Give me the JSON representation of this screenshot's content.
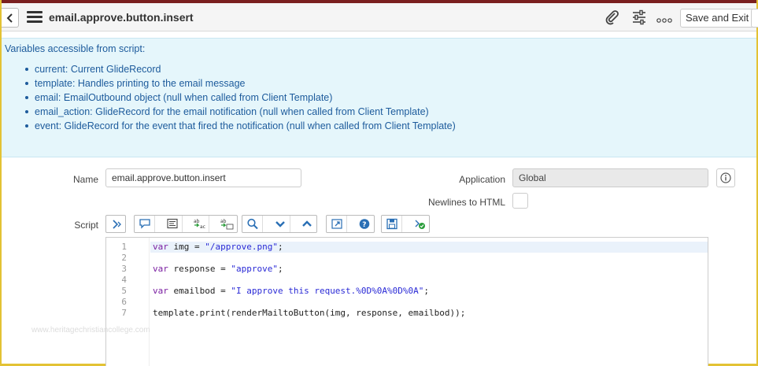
{
  "header": {
    "title": "email.approve.button.insert",
    "save_exit_label": "Save and Exit",
    "icons": [
      "back-chevron-icon",
      "hamburger-menu-icon",
      "paperclip-icon",
      "sliders-icon",
      "more-icon"
    ]
  },
  "info": {
    "title": "Variables accessible from script:",
    "items": [
      "current: Current GlideRecord",
      "template: Handles printing to the email message",
      "email: EmailOutbound object (null when called from Client Template)",
      "email_action: GlideRecord for the email notification (null when called from Client Template)",
      "event: GlideRecord for the event that fired the notification (null when called from Client Template)"
    ],
    "color": "#1d5b9c",
    "background": "#e5f6fb"
  },
  "form": {
    "name_label": "Name",
    "name_value": "email.approve.button.insert",
    "application_label": "Application",
    "application_value": "Global",
    "newlines_label": "Newlines to HTML",
    "script_label": "Script"
  },
  "editor": {
    "lines": [
      {
        "num": "1",
        "tokens": [
          {
            "t": "var",
            "c": "kw"
          },
          {
            "t": " img = ",
            "c": ""
          },
          {
            "t": "\"/approve.png\"",
            "c": "str"
          },
          {
            "t": ";",
            "c": ""
          }
        ]
      },
      {
        "num": "2",
        "tokens": []
      },
      {
        "num": "3",
        "tokens": [
          {
            "t": "var",
            "c": "kw"
          },
          {
            "t": " response = ",
            "c": ""
          },
          {
            "t": "\"approve\"",
            "c": "str"
          },
          {
            "t": ";",
            "c": ""
          }
        ]
      },
      {
        "num": "4",
        "tokens": []
      },
      {
        "num": "5",
        "tokens": [
          {
            "t": "var",
            "c": "kw"
          },
          {
            "t": " emailbod = ",
            "c": ""
          },
          {
            "t": "\"I approve this request.%0D%0A%0D%0A\"",
            "c": "str"
          },
          {
            "t": ";",
            "c": ""
          }
        ]
      },
      {
        "num": "6",
        "tokens": []
      },
      {
        "num": "7",
        "tokens": [
          {
            "t": "template.print(renderMailtoButton(img, response, emailbod));",
            "c": ""
          }
        ]
      }
    ]
  },
  "watermark": "www.heritagechristiancollege.com"
}
